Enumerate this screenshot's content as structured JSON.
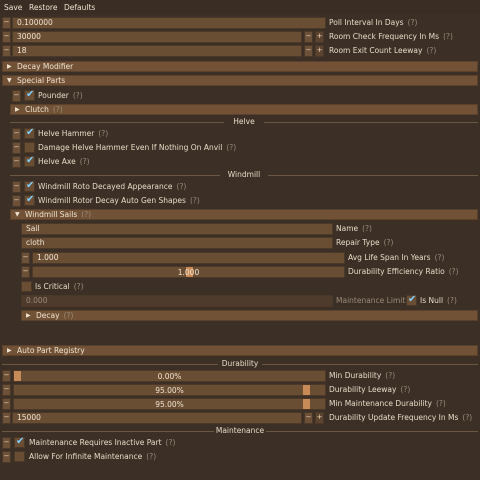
{
  "menu": [
    "Save",
    "Restore",
    "Defaults"
  ],
  "top_fields": [
    {
      "value": "0.100000",
      "label": "Poll Interval In Days"
    },
    {
      "value": "30000",
      "label": "Room Check Frequency In Ms"
    },
    {
      "value": "18",
      "label": "Room Exit Count Leeway"
    }
  ],
  "help_mark": "(?)",
  "minus": "−",
  "plus": "+",
  "checkmark": "✔",
  "decay_modifier": "Decay Modifier",
  "special_parts": "Special Parts",
  "pounder": "Pounder",
  "clutch": "Clutch",
  "helve_sep": "Helve",
  "helve_hammer": "Helve Hammer",
  "damage_helve": "Damage Helve Hammer Even If Nothing On Anvil",
  "helve_axe": "Helve Axe",
  "windmill_sep": "Windmill",
  "windmill_roto": "Windmill Roto Decayed Appearance",
  "windmill_rotor": "Windmill Rotor Decay Auto Gen Shapes",
  "windmill_sails": "Windmill Sails",
  "sails": {
    "name_value": "Sail",
    "name_label": "Name",
    "repair_value": "cloth",
    "repair_label": "Repair Type",
    "life_value": "1.000",
    "life_label": "Avg Life Span In Years",
    "eff_value": "1.000",
    "eff_label": "Durability Efficiency Ratio",
    "is_critical": "Is Critical",
    "maint_value": "0.000",
    "maint_label": "Maintenance Limit",
    "is_null": "Is Null",
    "decay": "Decay"
  },
  "auto_part": "Auto Part Registry",
  "durability_sep": "Durability",
  "durability": {
    "min_value": "0.00%",
    "min_label": "Min Durability",
    "min_frac": 0.0,
    "leeway_value": "95.00%",
    "leeway_label": "Durability Leeway",
    "leeway_frac": 0.95,
    "minmaint_value": "95.00%",
    "minmaint_label": "Min Maintenance Durability",
    "minmaint_frac": 0.95,
    "freq_value": "15000",
    "freq_label": "Durability Update Frequency In Ms"
  },
  "maintenance_sep": "Maintenance",
  "maint_inactive": "Maintenance Requires Inactive Part",
  "allow_infinite": "Allow For Infinite Maintenance"
}
